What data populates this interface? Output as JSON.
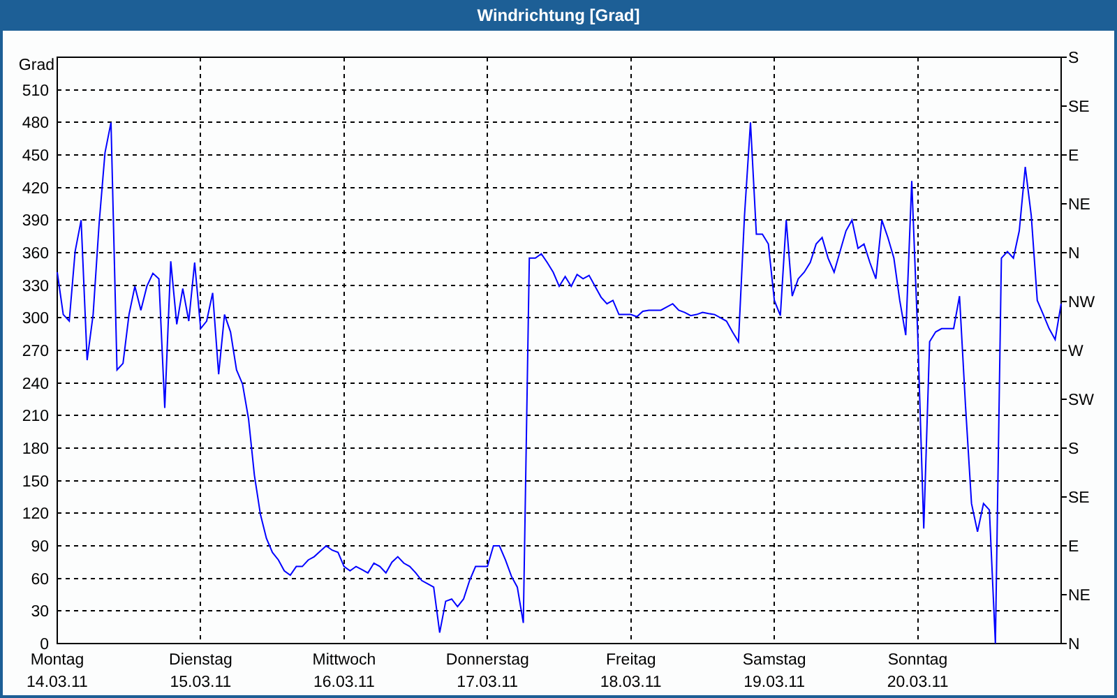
{
  "window": {
    "title": "Windrichtung [Grad]"
  },
  "chart": {
    "xtick_dates": [
      "14.03.11",
      "15.03.11",
      "16.03.11",
      "17.03.11",
      "18.03.11",
      "19.03.11",
      "20.03.11"
    ],
    "secondary_ytick_labels": [
      "S",
      "SE",
      "E",
      "NE",
      "N",
      "NW",
      "W",
      "SW",
      "S",
      "SE",
      "E",
      "NE",
      "N"
    ],
    "chart_data": {
      "type": "line",
      "grid": true,
      "ylabel": "Grad",
      "ylim": [
        0,
        540
      ],
      "yticks": [
        0,
        30,
        60,
        90,
        120,
        150,
        180,
        210,
        240,
        270,
        300,
        330,
        360,
        390,
        420,
        450,
        480,
        510
      ],
      "categories": [
        "Montag",
        null,
        null,
        null,
        null,
        null,
        null,
        null,
        null,
        null,
        null,
        null,
        null,
        null,
        null,
        null,
        null,
        null,
        null,
        null,
        null,
        null,
        null,
        null,
        "Dienstag",
        null,
        null,
        null,
        null,
        null,
        null,
        null,
        null,
        null,
        null,
        null,
        null,
        null,
        null,
        null,
        null,
        null,
        null,
        null,
        null,
        null,
        null,
        null,
        "Mittwoch",
        null,
        null,
        null,
        null,
        null,
        null,
        null,
        null,
        null,
        null,
        null,
        null,
        null,
        null,
        null,
        null,
        null,
        null,
        null,
        null,
        null,
        null,
        null,
        "Donnerstag",
        null,
        null,
        null,
        null,
        null,
        null,
        null,
        null,
        null,
        null,
        null,
        null,
        null,
        null,
        null,
        null,
        null,
        null,
        null,
        null,
        null,
        null,
        null,
        "Freitag",
        null,
        null,
        null,
        null,
        null,
        null,
        null,
        null,
        null,
        null,
        null,
        null,
        null,
        null,
        null,
        null,
        null,
        null,
        null,
        null,
        null,
        null,
        null,
        "Samstag",
        null,
        null,
        null,
        null,
        null,
        null,
        null,
        null,
        null,
        null,
        null,
        null,
        null,
        null,
        null,
        null,
        null,
        null,
        null,
        null,
        null,
        null,
        null,
        "Sonntag",
        null,
        null,
        null,
        null,
        null,
        null,
        null,
        null,
        null,
        null,
        null,
        null,
        null,
        null,
        null,
        null,
        null,
        null,
        null,
        null,
        null,
        null,
        null,
        null
      ],
      "series": [
        {
          "color": "#0000ff",
          "values": [
            342,
            303,
            297,
            361,
            390,
            261,
            303,
            387,
            452,
            480,
            252,
            258,
            303,
            329,
            307,
            329,
            341,
            336,
            217,
            352,
            294,
            327,
            297,
            351,
            290,
            297,
            323,
            248,
            303,
            287,
            252,
            239,
            207,
            155,
            119,
            97,
            84,
            77,
            67,
            63,
            71,
            71,
            77,
            80,
            85,
            90,
            86,
            84,
            71,
            67,
            71,
            68,
            65,
            74,
            71,
            65,
            75,
            80,
            74,
            71,
            65,
            58,
            55,
            52,
            10,
            39,
            41,
            34,
            41,
            58,
            71,
            71,
            71,
            90,
            90,
            77,
            62,
            52,
            19,
            355,
            355,
            359,
            351,
            342,
            329,
            338,
            329,
            340,
            336,
            339,
            329,
            319,
            313,
            316,
            303,
            303,
            303,
            301,
            306,
            307,
            307,
            307,
            310,
            313,
            307,
            305,
            302,
            303,
            305,
            304,
            303,
            300,
            297,
            287,
            278,
            394,
            480,
            377,
            377,
            368,
            316,
            302,
            390,
            320,
            336,
            342,
            351,
            368,
            374,
            355,
            342,
            361,
            380,
            390,
            364,
            368,
            351,
            336,
            390,
            374,
            355,
            316,
            284,
            426,
            284,
            106,
            278,
            287,
            290,
            290,
            290,
            320,
            219,
            129,
            103,
            129,
            123,
            0,
            355,
            361,
            355,
            380,
            439,
            394,
            316,
            303,
            290,
            280,
            313
          ]
        }
      ]
    }
  }
}
